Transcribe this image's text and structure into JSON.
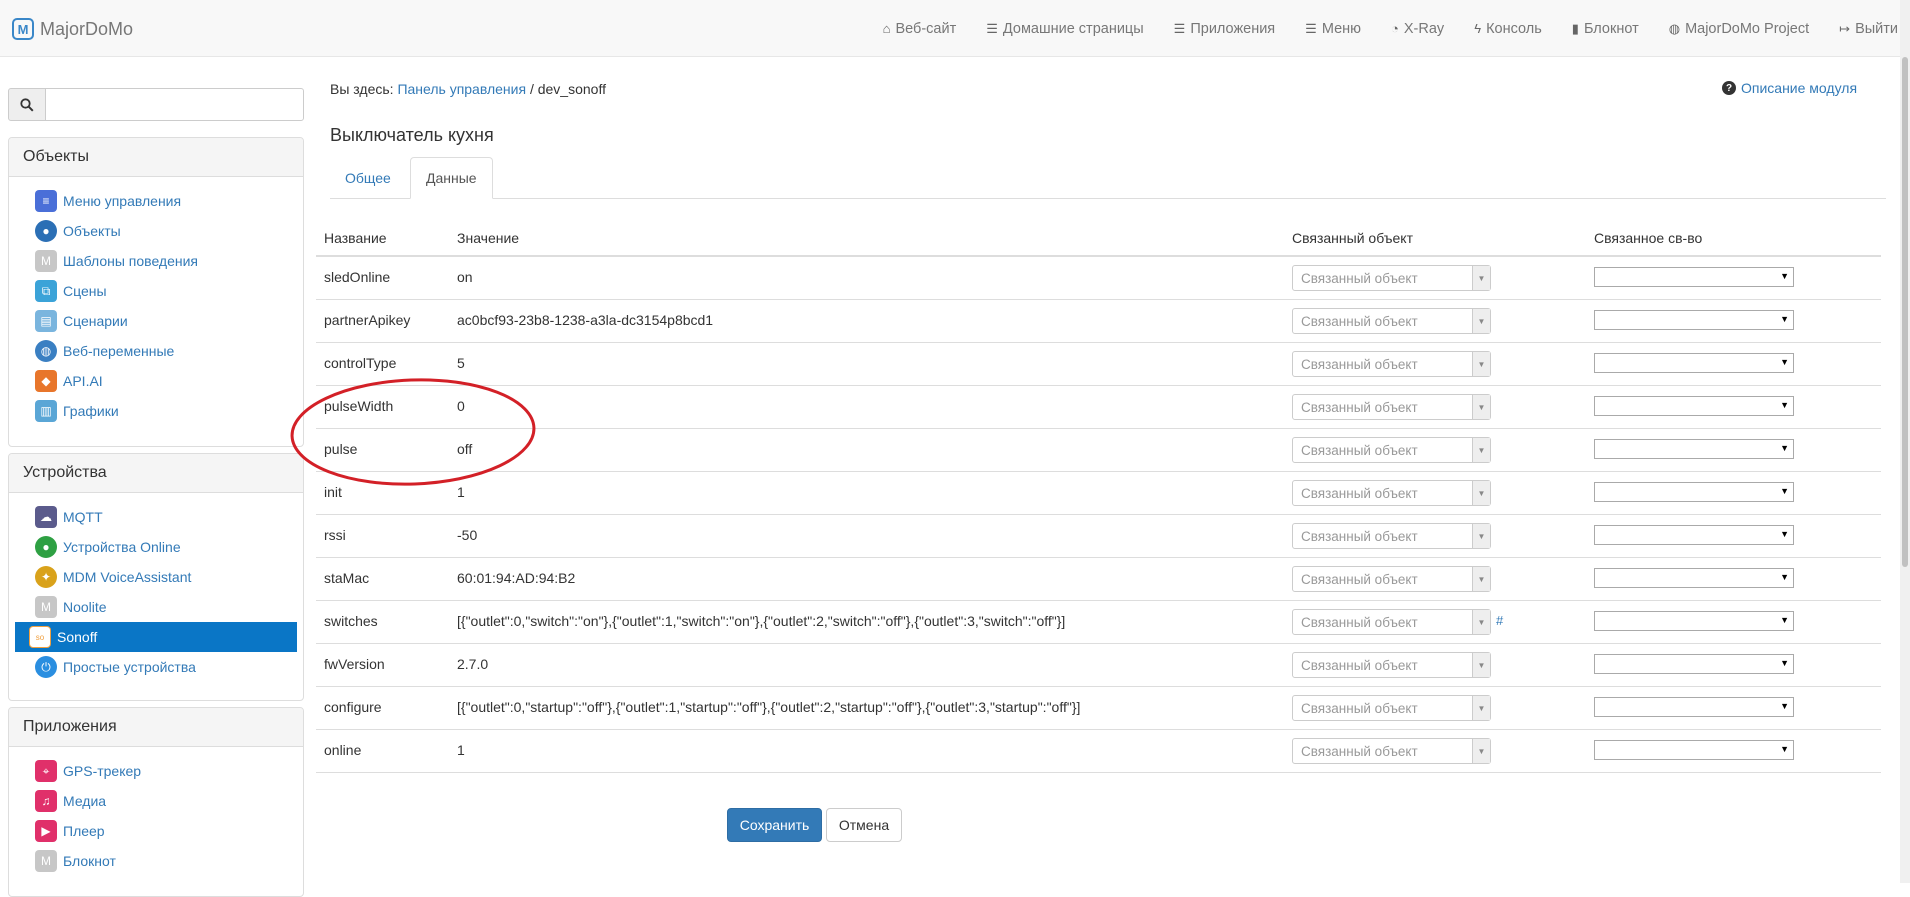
{
  "brand": {
    "name": "MajorDoMo"
  },
  "navbar": [
    {
      "label": "Веб-сайт",
      "icon": "home-icon"
    },
    {
      "label": "Домашние страницы",
      "icon": "list-icon"
    },
    {
      "label": "Приложения",
      "icon": "list-icon"
    },
    {
      "label": "Меню",
      "icon": "list-icon"
    },
    {
      "label": "X-Ray",
      "icon": "dashboard-icon"
    },
    {
      "label": "Консоль",
      "icon": "flash-icon"
    },
    {
      "label": "Блокнот",
      "icon": "book-icon"
    },
    {
      "label": "MajorDoMo Project",
      "icon": "globe-icon"
    },
    {
      "label": "Выйти",
      "icon": "logout-icon"
    }
  ],
  "search": {
    "placeholder": ""
  },
  "sidebar": {
    "objects": {
      "title": "Объекты",
      "items": [
        {
          "label": "Меню управления",
          "icon": "menu-icon",
          "color": "#4a6fd8"
        },
        {
          "label": "Объекты",
          "icon": "globe-icon",
          "color": "#2b6fb5"
        },
        {
          "label": "Шаблоны поведения",
          "icon": "majordomo-icon",
          "color": "#c7c7c7"
        },
        {
          "label": "Сцены",
          "icon": "scenes-icon",
          "color": "#3ba3d8"
        },
        {
          "label": "Сценарии",
          "icon": "scripts-icon",
          "color": "#7ab5de"
        },
        {
          "label": "Веб-переменные",
          "icon": "web-globe-icon",
          "color": "#3a7fc2"
        },
        {
          "label": "API.AI",
          "icon": "cube-icon",
          "color": "#e8762b"
        },
        {
          "label": "Графики",
          "icon": "chart-icon",
          "color": "#5aa6d6"
        }
      ]
    },
    "devices": {
      "title": "Устройства",
      "items": [
        {
          "label": "MQTT",
          "icon": "mqtt-icon",
          "color": "#5b5b8c"
        },
        {
          "label": "Устройства Online",
          "icon": "online-icon",
          "color": "#2ea043"
        },
        {
          "label": "MDM VoiceAssistant",
          "icon": "voice-icon",
          "color": "#d9a21b"
        },
        {
          "label": "Noolite",
          "icon": "majordomo-icon",
          "color": "#c7c7c7"
        },
        {
          "label": "Sonoff",
          "icon": "sonoff-icon",
          "color": "#f0a040",
          "active": true
        },
        {
          "label": "Простые устройства",
          "icon": "power-icon",
          "color": "#2a8ee0"
        }
      ]
    },
    "apps": {
      "title": "Приложения",
      "items": [
        {
          "label": "GPS-трекер",
          "icon": "gps-icon",
          "color": "#e0306a"
        },
        {
          "label": "Медиа",
          "icon": "music-icon",
          "color": "#e0306a"
        },
        {
          "label": "Плеер",
          "icon": "play-icon",
          "color": "#e0306a"
        },
        {
          "label": "Блокнот",
          "icon": "majordomo-icon",
          "color": "#c7c7c7"
        }
      ]
    }
  },
  "breadcrumb": {
    "prefix": "Вы здесь: ",
    "link": "Панель управления",
    "separator": " / ",
    "current": "dev_sonoff"
  },
  "help_link": "Описание модуля",
  "page_title": "Выключатель кухня",
  "tabs": [
    {
      "label": "Общее"
    },
    {
      "label": "Данные",
      "active": true
    }
  ],
  "table": {
    "headers": [
      "Название",
      "Значение",
      "Связанный объект",
      "Связанное св-во"
    ],
    "object_placeholder": "Связанный объект",
    "rows": [
      {
        "name": "sledOnline",
        "value": "on"
      },
      {
        "name": "partnerApikey",
        "value": "ac0bcf93-23b8-1238-a3la-dc3154p8bcd1"
      },
      {
        "name": "controlType",
        "value": "5"
      },
      {
        "name": "pulseWidth",
        "value": "0"
      },
      {
        "name": "pulse",
        "value": "off"
      },
      {
        "name": "init",
        "value": "1"
      },
      {
        "name": "rssi",
        "value": "-50"
      },
      {
        "name": "staMac",
        "value": "60:01:94:AD:94:B2"
      },
      {
        "name": "switches",
        "value": "[{\"outlet\":0,\"switch\":\"on\"},{\"outlet\":1,\"switch\":\"on\"},{\"outlet\":2,\"switch\":\"off\"},{\"outlet\":3,\"switch\":\"off\"}]",
        "link": "#"
      },
      {
        "name": "fwVersion",
        "value": "2.7.0"
      },
      {
        "name": "configure",
        "value": "[{\"outlet\":0,\"startup\":\"off\"},{\"outlet\":1,\"startup\":\"off\"},{\"outlet\":2,\"startup\":\"off\"},{\"outlet\":3,\"startup\":\"off\"}]"
      },
      {
        "name": "online",
        "value": "1"
      }
    ]
  },
  "buttons": {
    "save": "Сохранить",
    "cancel": "Отмена"
  },
  "colors": {
    "accent": "#337ab7",
    "active": "#0a76c6",
    "annotation": "#d32027"
  }
}
